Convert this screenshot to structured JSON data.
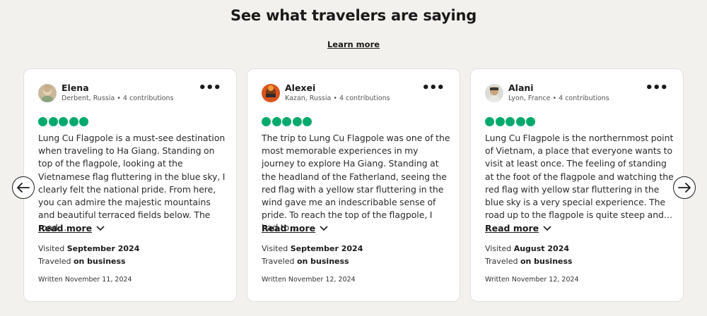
{
  "heading": "See what travelers are saying",
  "learn_more": "Learn more",
  "icons": {
    "rating": "bubble-rating-icon",
    "menu": "more-options-icon",
    "expand": "chevron-down-icon",
    "prev": "arrow-left-icon",
    "next": "arrow-right-icon"
  },
  "colors": {
    "rating": "#00aa6c",
    "background": "#f2f1ed"
  },
  "reviews": [
    {
      "name": "Elena",
      "location": "Derbent, Russia",
      "contributions": "4 contributions",
      "meta": "Derbent, Russia • 4 contributions",
      "rating": 5,
      "text": "Lung Cu Flagpole is a must-see destination when traveling to Ha Giang. Standing on top of the flagpole, looking at the Vietnamese flag fluttering in the blue sky, I clearly felt the national pride. From here, you can admire the majestic mountains and beautiful terraced fields below. The road…",
      "read_more": "Read more",
      "visited_prefix": "Visited",
      "visited_date": "September 2024",
      "traveled_prefix": "Traveled",
      "traveled_type": "on business",
      "written": "Written November 11, 2024"
    },
    {
      "name": "Alexei",
      "location": "Kazan, Russia",
      "contributions": "4 contributions",
      "meta": "Kazan, Russia • 4 contributions",
      "rating": 5,
      "text": "The trip to Lung Cu Flagpole was one of the most memorable experiences in my journey to explore Ha Giang. Standing at the headland of the Fatherland, seeing the red flag with a yellow star fluttering in the wind gave me an indescribable sense of pride. To reach the top of the flagpole, I had to…",
      "read_more": "Read more",
      "visited_prefix": "Visited",
      "visited_date": "September 2024",
      "traveled_prefix": "Traveled",
      "traveled_type": "on business",
      "written": "Written November 12, 2024"
    },
    {
      "name": "Alani",
      "location": "Lyon, France",
      "contributions": "4 contributions",
      "meta": "Lyon, France • 4 contributions",
      "rating": 5,
      "text": "Lung Cu Flagpole is the northernmost point of Vietnam, a place that everyone wants to visit at least once. The feeling of standing at the foot of the flagpole and watching the red flag with yellow star fluttering in the blue sky is a very special experience. The road up to the flagpole is quite steep and…",
      "read_more": "Read more",
      "visited_prefix": "Visited",
      "visited_date": "August 2024",
      "traveled_prefix": "Traveled",
      "traveled_type": "on business",
      "written": "Written November 12, 2024"
    }
  ]
}
